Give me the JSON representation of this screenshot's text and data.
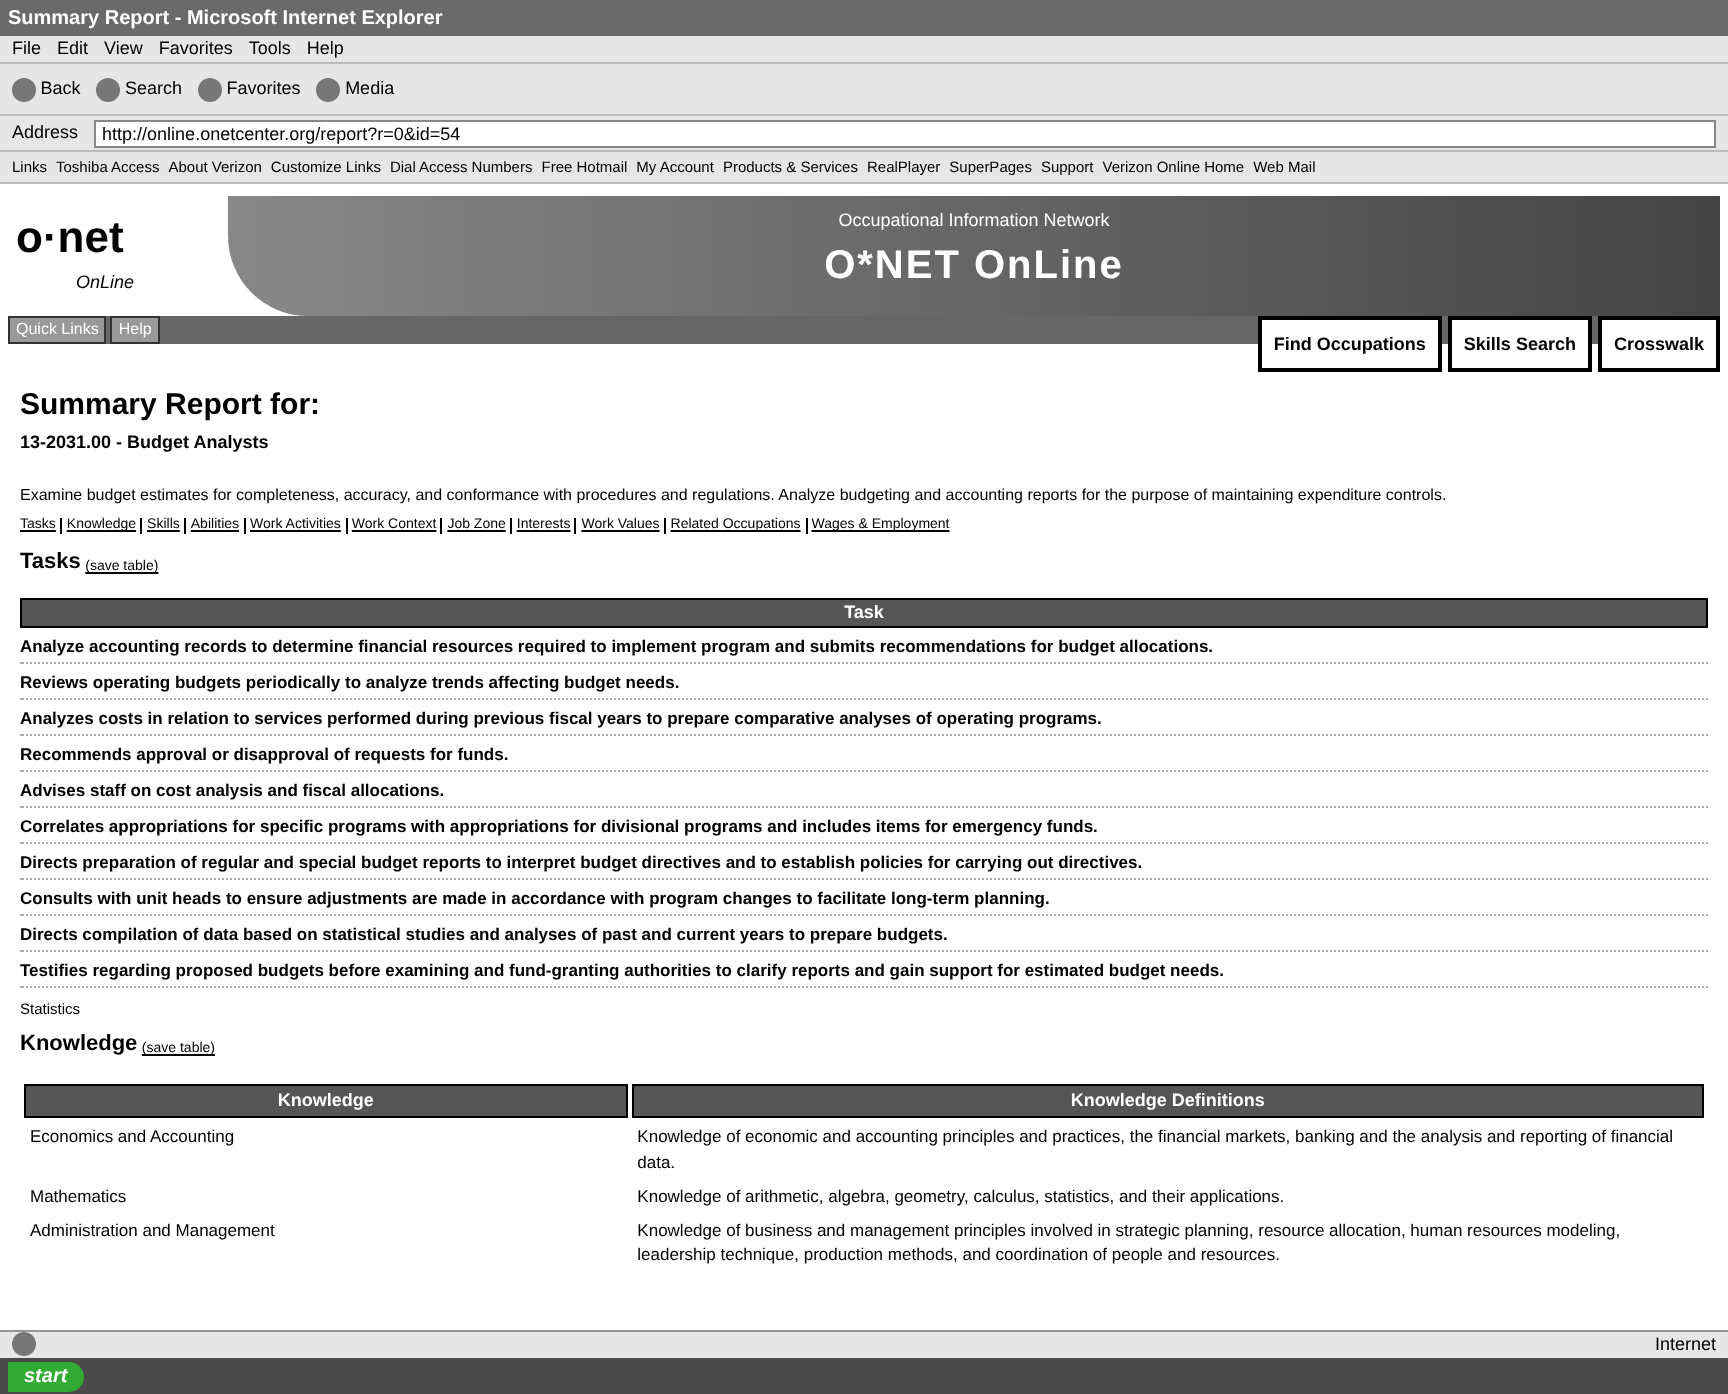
{
  "window": {
    "title": "Summary Report - Microsoft Internet Explorer"
  },
  "menu": [
    "File",
    "Edit",
    "View",
    "Favorites",
    "Tools",
    "Help"
  ],
  "toolbar": [
    "Back",
    "Search",
    "Favorites",
    "Media"
  ],
  "address": {
    "label": "Address",
    "value": "http://online.onetcenter.org/report?r=0&id=54"
  },
  "links_bar": {
    "label": "Links",
    "items": [
      "Toshiba Access",
      "About Verizon",
      "Customize Links",
      "Dial Access Numbers",
      "Free Hotmail",
      "My Account",
      "Products & Services",
      "RealPlayer",
      "SuperPages",
      "Support",
      "Verizon Online Home",
      "Web Mail"
    ]
  },
  "banner": {
    "logo": "o·net",
    "logo_sub": "OnLine",
    "tagline": "Occupational Information Network",
    "title": "O*NET OnLine",
    "nav": [
      "Quick Links",
      "Help"
    ],
    "buttons": [
      "Find Occupations",
      "Skills Search",
      "Crosswalk"
    ]
  },
  "report": {
    "heading": "Summary Report for:",
    "occupation": "13-2031.00 - Budget Analysts",
    "description": "Examine budget estimates for completeness, accuracy, and conformance with procedures and regulations. Analyze budgeting and accounting reports for the purpose of maintaining expenditure controls.",
    "sections": [
      "Tasks",
      "Knowledge",
      "Skills",
      "Abilities",
      "Work Activities",
      "Work Context",
      "Job Zone",
      "Interests",
      "Work Values",
      "Related Occupations",
      "Wages & Employment"
    ]
  },
  "tasks": {
    "title": "Tasks",
    "save": "(save table)",
    "column": "Task",
    "rows": [
      "Analyze accounting records to determine financial resources required to implement program and submits recommendations for budget allocations.",
      "Reviews operating budgets periodically to analyze trends affecting budget needs.",
      "Analyzes costs in relation to services performed during previous fiscal years to prepare comparative analyses of operating programs.",
      "Recommends approval or disapproval of requests for funds.",
      "Advises staff on cost analysis and fiscal allocations.",
      "Correlates appropriations for specific programs with appropriations for divisional programs and includes items for emergency funds.",
      "Directs preparation of regular and special budget reports to interpret budget directives and to establish policies for carrying out directives.",
      "Consults with unit heads to ensure adjustments are made in accordance with program changes to facilitate long-term planning.",
      "Directs compilation of data based on statistical studies and analyses of past and current years to prepare budgets.",
      "Testifies regarding proposed budgets before examining and fund-granting authorities to clarify reports and gain support for estimated budget needs."
    ],
    "footer": "Statistics"
  },
  "knowledge": {
    "title": "Knowledge",
    "save": "(save table)",
    "columns": [
      "Knowledge",
      "Knowledge Definitions"
    ],
    "rows": [
      [
        "Economics and Accounting",
        "Knowledge of economic and accounting principles and practices, the financial markets, banking and the analysis and reporting of financial data."
      ],
      [
        "Mathematics",
        "Knowledge of arithmetic, algebra, geometry, calculus, statistics, and their applications."
      ],
      [
        "Administration and Management",
        "Knowledge of business and management principles involved in strategic planning, resource allocation, human resources modeling, leadership technique, production methods, and coordination of people and resources."
      ]
    ]
  },
  "status_bar": {
    "zone": "Internet"
  },
  "taskbar": {
    "start": "start"
  }
}
